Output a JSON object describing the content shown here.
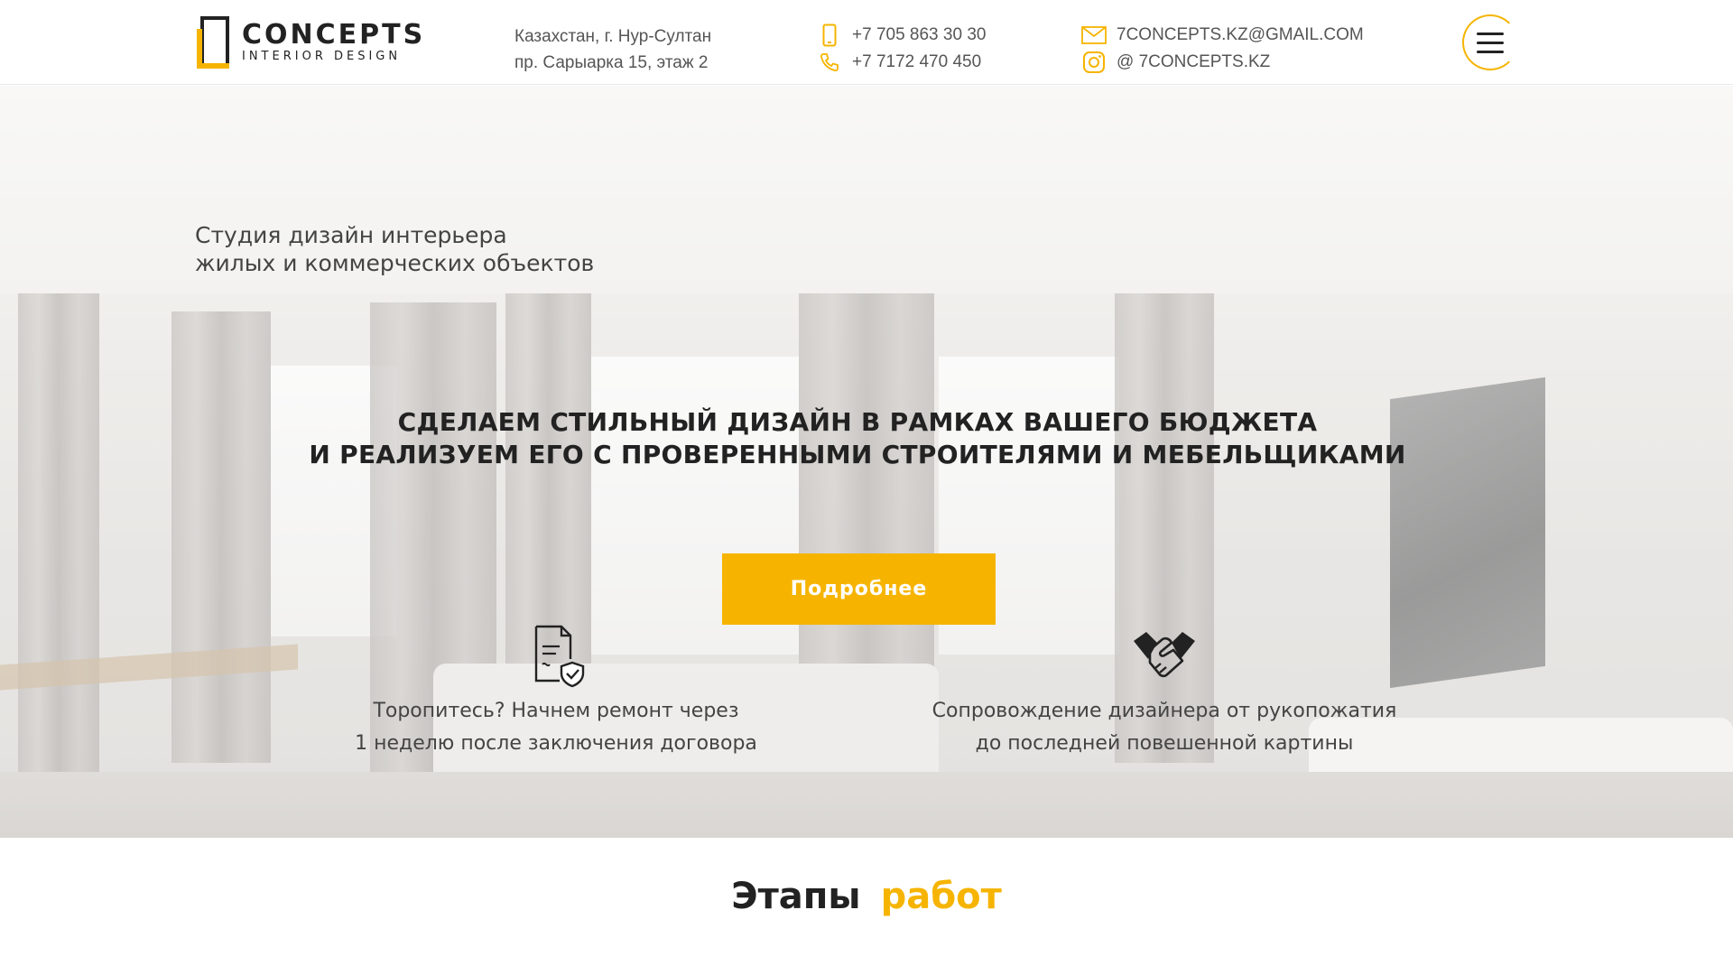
{
  "header": {
    "logo": {
      "title": "CONCEPTS",
      "subtitle": "INTERIOR DESIGN"
    },
    "address": {
      "line1": "Казахстан, г. Нур-Султан",
      "line2": "пр. Сарыарка 15, этаж 2"
    },
    "phones": [
      {
        "icon": "mobile-phone-icon",
        "text": "+7 705 863 30 30"
      },
      {
        "icon": "phone-handset-icon",
        "text": "+7 7172 470 450"
      }
    ],
    "contacts": [
      {
        "icon": "mail-icon",
        "text": "7CONCEPTS.KZ@GMAIL.COM"
      },
      {
        "icon": "instagram-icon",
        "text": "@ 7CONCEPTS.KZ"
      }
    ],
    "menu_icon": "hamburger-menu-icon",
    "accent_color": "#f6b400"
  },
  "hero": {
    "tagline": {
      "line1": "Студия дизайн интерьера",
      "line2": "жилых и коммерческих объектов"
    },
    "headline": {
      "line1": "СДЕЛАЕМ СТИЛЬНЫЙ ДИЗАЙН В РАМКАХ ВАШЕГО БЮДЖЕТА",
      "line2": "И РЕАЛИЗУЕМ ЕГО С ПРОВЕРЕННЫМИ СТРОИТЕЛЯМИ И МЕБЕЛЬЩИКАМИ"
    },
    "cta_label": "Подробнее",
    "features": [
      {
        "icon": "contract-shield-icon",
        "line1": "Торопитесь? Начнем ремонт через",
        "line2": "1 неделю после заключения договора"
      },
      {
        "icon": "handshake-icon",
        "line1": "Сопровождение дизайнера от рукопожатия",
        "line2": "до последней повешенной картины"
      }
    ]
  },
  "section": {
    "title_word1": "Этапы",
    "title_word2": "работ"
  }
}
